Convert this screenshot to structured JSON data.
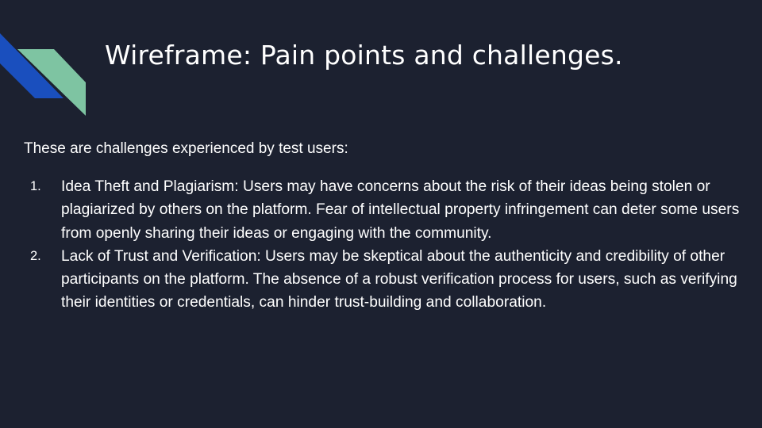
{
  "slide": {
    "title": "Wireframe: Pain points and challenges.",
    "intro": "These are challenges experienced by test users:",
    "items": [
      {
        "number": "1.",
        "text": "Idea Theft and Plagiarism: Users may have concerns about the risk of their ideas being stolen or plagiarized by others on the platform. Fear of intellectual property infringement can deter some users from openly sharing their ideas or engaging with the community."
      },
      {
        "number": "2.",
        "text": "Lack of Trust and Verification: Users may be skeptical about the authenticity and credibility of other participants on the platform. The absence of a robust verification process for users, such as verifying their identities or credentials, can hinder trust-building and collaboration."
      }
    ]
  },
  "colors": {
    "background": "#1c2130",
    "text": "#ffffff",
    "accent_blue": "#1a4fbe",
    "accent_green": "#7ec4a2"
  }
}
